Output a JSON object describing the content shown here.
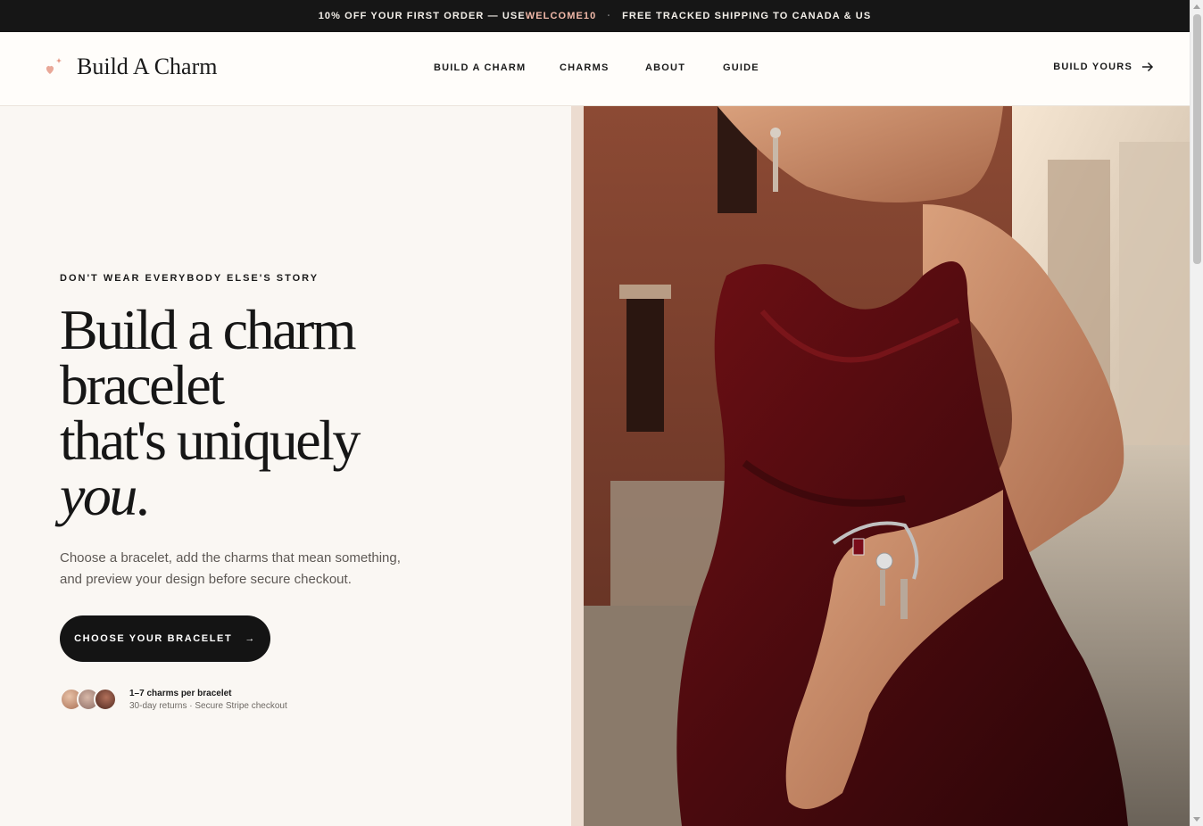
{
  "announcement": {
    "part1": "10% OFF YOUR FIRST ORDER — USE ",
    "code": "WELCOME10",
    "separator": "·",
    "part2": "FREE TRACKED SHIPPING TO CANADA & US"
  },
  "header": {
    "logo_text": "Build A Charm",
    "nav": [
      "BUILD A CHARM",
      "CHARMS",
      "ABOUT",
      "GUIDE"
    ],
    "cta_label": "BUILD YOURS"
  },
  "hero": {
    "eyebrow": "DON'T WEAR EVERYBODY ELSE'S STORY",
    "headline_line1": "Build a charm",
    "headline_line2": "bracelet",
    "headline_line3": "that's uniquely",
    "headline_em": "you",
    "headline_end": ".",
    "subtext": "Choose a bracelet, add the charms that mean something, and preview your design before secure checkout.",
    "button_label": "CHOOSE YOUR BRACELET",
    "button_arrow": "→",
    "trust_title": "1–7 charms per bracelet",
    "trust_sub": "30-day returns · Secure Stripe checkout"
  },
  "colors": {
    "accent": "#f0b8a8",
    "dark": "#161616",
    "background": "#faf7f3"
  }
}
